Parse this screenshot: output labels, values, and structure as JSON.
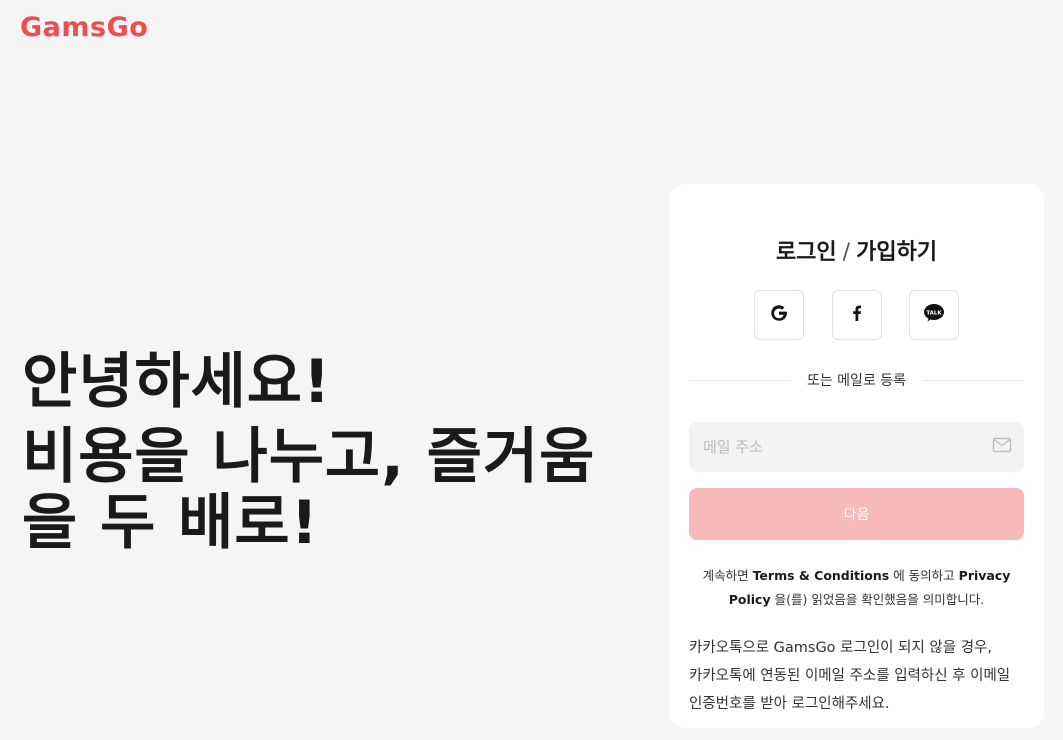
{
  "brand": {
    "logo": "GamsGo",
    "color": "#ee4d4f"
  },
  "hero": {
    "line1": "안녕하세요!",
    "line2": "비용을 나누고, 즐거움을 두 배로!"
  },
  "login": {
    "title_login": "로그인",
    "title_sep": "/",
    "title_signup": "가입하기",
    "social": [
      {
        "name": "google",
        "icon": "google-icon"
      },
      {
        "name": "facebook",
        "icon": "facebook-icon"
      },
      {
        "name": "kakaotalk",
        "icon": "kakaotalk-icon",
        "icon_text": "TALK"
      }
    ],
    "divider_text": "또는 메일로 등록",
    "email_placeholder": "메일 주소",
    "email_value": "",
    "next_label": "다음",
    "next_color": "#f8b9b9",
    "terms_prefix": "계속하면 ",
    "terms_link": "Terms & Conditions",
    "terms_middle": " 에 동의하고 ",
    "privacy_link": "Privacy Policy",
    "terms_suffix": " 을(를) 읽었음을 확인했음을 의미합니다.",
    "kakao_note": "카카오톡으로 GamsGo 로그인이 되지 않을 경우, 카카오톡에 연동된 이메일 주소를 입력하신 후 이메일 인증번호를 받아 로그인해주세요."
  }
}
